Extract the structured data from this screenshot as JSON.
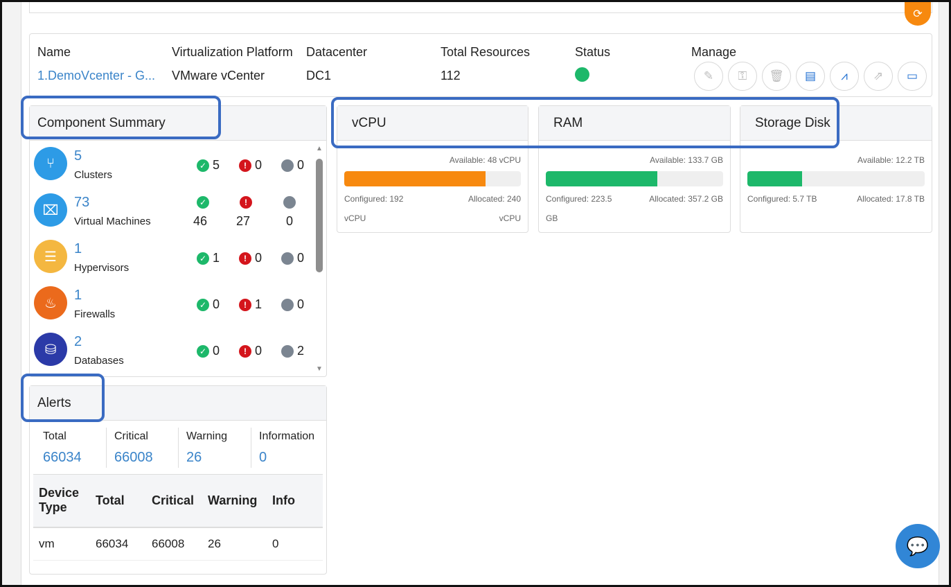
{
  "header": {
    "columns": {
      "name": {
        "label": "Name",
        "value": "1.DemoVcenter - G..."
      },
      "platform": {
        "label": "Virtualization Platform",
        "value": "VMware vCenter"
      },
      "datacenter": {
        "label": "Datacenter",
        "value": "DC1"
      },
      "resources": {
        "label": "Total Resources",
        "value": "112"
      },
      "status": {
        "label": "Status",
        "color": "#1db86a"
      },
      "manage": {
        "label": "Manage"
      }
    },
    "manage_icons": [
      "edit-icon",
      "key-icon",
      "trash-icon",
      "book-icon",
      "chart-icon",
      "external-link-icon",
      "console-icon"
    ]
  },
  "component_summary": {
    "title": "Component Summary",
    "items": [
      {
        "count": "5",
        "name": "Clusters",
        "ok": "5",
        "err": "0",
        "na": "0",
        "color": "#2d9be6",
        "icon": "cluster-icon"
      },
      {
        "count": "73",
        "name": "Virtual Machines",
        "ok": "46",
        "err": "27",
        "na": "0",
        "color": "#2d9be6",
        "icon": "vm-icon"
      },
      {
        "count": "1",
        "name": "Hypervisors",
        "ok": "1",
        "err": "0",
        "na": "0",
        "color": "#f4b740",
        "icon": "server-icon"
      },
      {
        "count": "1",
        "name": "Firewalls",
        "ok": "0",
        "err": "1",
        "na": "0",
        "color": "#eb6a1c",
        "icon": "fire-icon"
      },
      {
        "count": "2",
        "name": "Databases",
        "ok": "0",
        "err": "0",
        "na": "2",
        "color": "#2b3aa8",
        "icon": "database-icon"
      }
    ]
  },
  "resources": {
    "vcpu": {
      "title": "vCPU",
      "available": "Available: 48 vCPU",
      "configured": "Configured: 192",
      "configured_unit": "vCPU",
      "allocated": "Allocated: 240",
      "allocated_unit": "vCPU",
      "fill_fraction": 0.8,
      "color": "#f7890f"
    },
    "ram": {
      "title": "RAM",
      "available": "Available: 133.7 GB",
      "configured": "Configured: 223.5",
      "configured_unit": "GB",
      "allocated": "Allocated: 357.2 GB",
      "allocated_unit": "",
      "fill_fraction": 0.63,
      "color": "#1db86a"
    },
    "storage": {
      "title": "Storage Disk",
      "available": "Available: 12.2 TB",
      "configured": "Configured: 5.7 TB",
      "configured_unit": "",
      "allocated": "Allocated: 17.8 TB",
      "allocated_unit": "",
      "fill_fraction": 0.31,
      "color": "#1db86a"
    }
  },
  "alerts": {
    "title": "Alerts",
    "summary": [
      {
        "label": "Total",
        "value": "66034"
      },
      {
        "label": "Critical",
        "value": "66008"
      },
      {
        "label": "Warning",
        "value": "26"
      },
      {
        "label": "Information",
        "value": "0"
      }
    ],
    "table": {
      "headers": [
        "Device Type",
        "Total",
        "Critical",
        "Warning",
        "Info"
      ],
      "rows": [
        [
          "vm",
          "66034",
          "66008",
          "26",
          "0"
        ]
      ]
    }
  }
}
